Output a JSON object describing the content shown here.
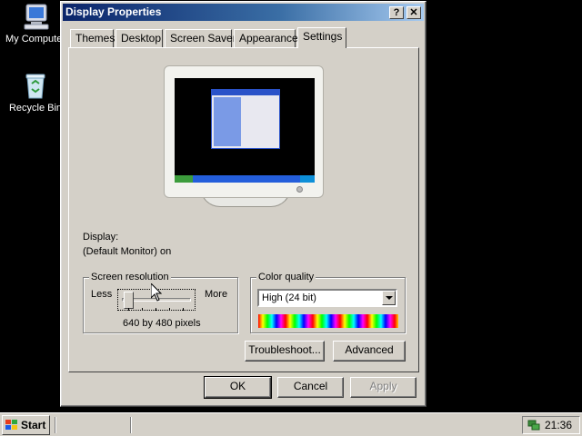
{
  "desktop": {
    "icons": [
      {
        "label": "My Computer",
        "icon": "my-computer-icon"
      },
      {
        "label": "Recycle Bin",
        "icon": "recycle-bin-icon"
      }
    ]
  },
  "window": {
    "title": "Display Properties",
    "help_label": "?",
    "close_label": "✕",
    "tabs": [
      {
        "label": "Themes"
      },
      {
        "label": "Desktop"
      },
      {
        "label": "Screen Saver"
      },
      {
        "label": "Appearance"
      },
      {
        "label": "Settings",
        "active": true
      }
    ],
    "display_label": "Display:",
    "display_value": "(Default Monitor) on",
    "screen_resolution": {
      "legend": "Screen resolution",
      "less_label": "Less",
      "more_label": "More",
      "value_text": "640 by 480 pixels",
      "slider_level": 0
    },
    "color_quality": {
      "legend": "Color quality",
      "selected": "High (24 bit)"
    },
    "troubleshoot_label": "Troubleshoot...",
    "advanced_label": "Advanced",
    "ok_label": "OK",
    "cancel_label": "Cancel",
    "apply_label": "Apply"
  },
  "taskbar": {
    "start_label": "Start",
    "clock": "21:36"
  }
}
